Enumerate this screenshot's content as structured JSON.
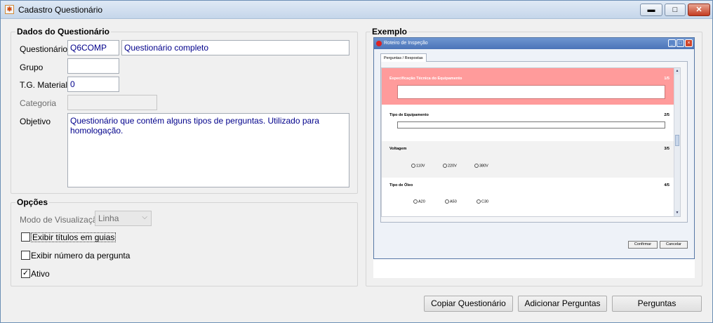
{
  "window": {
    "title": "Cadastro Questionário",
    "minimize": "▬",
    "maximize": "□",
    "close": "✕"
  },
  "dados": {
    "group_title": "Dados do Questionário",
    "questionario_label": "Questionário",
    "questionario_code": "Q6COMP",
    "questionario_name": "Questionário completo",
    "grupo_label": "Grupo",
    "grupo_value": "",
    "tg_material_label": "T.G. Material",
    "tg_material_value": "0",
    "categoria_label": "Categoria",
    "categoria_value": "",
    "objetivo_label": "Objetivo",
    "objetivo_value": "Questionário que contém alguns tipos de perguntas. Utilizado para homologação."
  },
  "opcoes": {
    "group_title": "Opções",
    "modo_label": "Modo de Visualização",
    "modo_value": "Linha",
    "exibir_titulos_label": "Exibir títulos em guias",
    "exibir_titulos_checked": false,
    "exibir_numero_label": "Exibir número da pergunta",
    "exibir_numero_checked": false,
    "ativo_label": "Ativo",
    "ativo_checked": true
  },
  "exemplo": {
    "group_title": "Exemplo",
    "preview": {
      "title": "Roteiro de Inspeção",
      "tab": "Perguntas / Respostas",
      "questions": [
        {
          "title": "Especificação Técnica do Equipamento",
          "number": "1/5"
        },
        {
          "title": "Tipo de Equipamento",
          "number": "2/5"
        },
        {
          "title": "Voltagem",
          "number": "3/5",
          "options": [
            "110V",
            "220V",
            "380V"
          ]
        },
        {
          "title": "Tipo de Óleo",
          "number": "4/5",
          "options": [
            "A20",
            "A50",
            "C30"
          ]
        }
      ],
      "confirm": "Confirmar",
      "cancel": "Cancelar"
    }
  },
  "buttons": {
    "copiar": "Copiar Questionário",
    "adicionar": "Adicionar Perguntas",
    "perguntas": "Perguntas"
  },
  "colors": {
    "highlight_question": "#ff9b9b",
    "input_text": "#00008b"
  }
}
